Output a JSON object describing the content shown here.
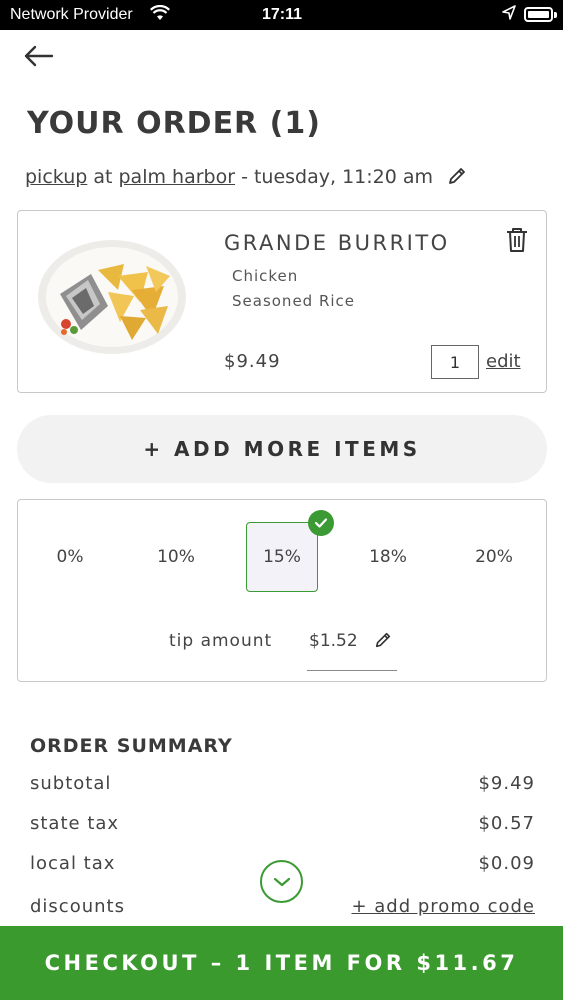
{
  "status_bar": {
    "carrier": "Network Provider",
    "time": "17:11"
  },
  "page": {
    "title": "YOUR ORDER (1)"
  },
  "pickup": {
    "mode": "pickup",
    "at": "at",
    "location": "palm harbor",
    "when": "- tuesday, 11:20 am"
  },
  "order_item": {
    "name": "GRANDE BURRITO",
    "modifiers": [
      "Chicken",
      "Seasoned Rice"
    ],
    "price": "$9.49",
    "quantity": "1",
    "edit_label": "edit"
  },
  "add_more_label": "+ ADD MORE ITEMS",
  "tip": {
    "options": [
      "0%",
      "10%",
      "15%",
      "18%",
      "20%"
    ],
    "selected": "15%",
    "amount_label": "tip amount",
    "amount": "$1.52"
  },
  "summary": {
    "title": "ORDER SUMMARY",
    "rows": [
      {
        "label": "subtotal",
        "value": "$9.49"
      },
      {
        "label": "state tax",
        "value": "$0.57"
      },
      {
        "label": "local tax",
        "value": "$0.09"
      },
      {
        "label": "discounts",
        "value": "+ add promo code"
      }
    ]
  },
  "checkout_label": "CHECKOUT – 1 ITEM FOR $11.67",
  "colors": {
    "accent_green": "#3a9a2e",
    "border_gray": "#c9c9c9",
    "pill_bg": "#f2f2f2"
  }
}
